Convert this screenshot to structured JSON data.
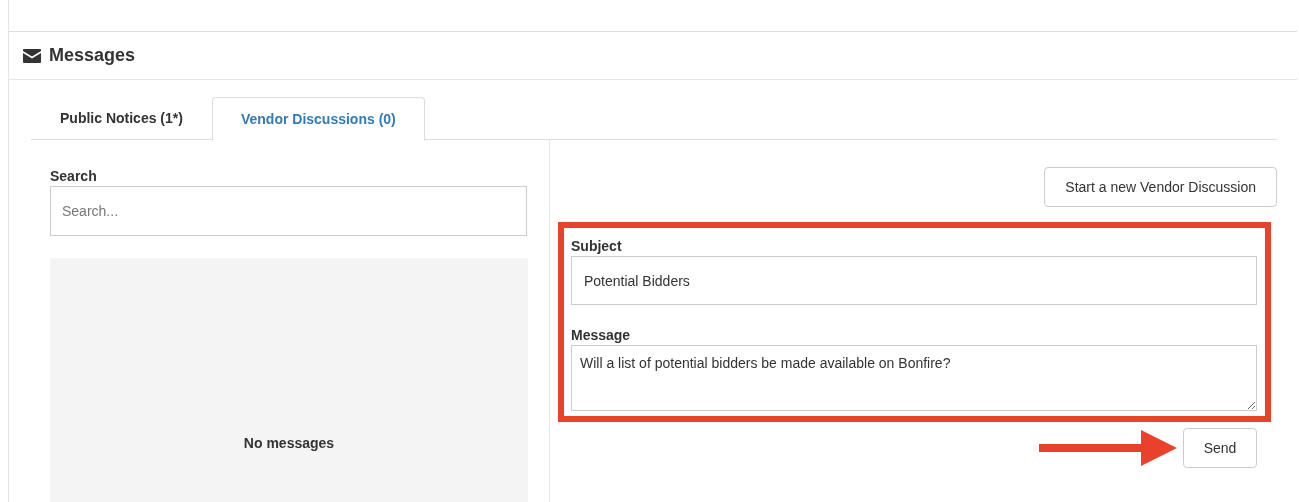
{
  "panel": {
    "title": "Messages"
  },
  "tabs": [
    {
      "label": "Public Notices (1*)",
      "selected": false
    },
    {
      "label": "Vendor Discussions (0)",
      "selected": true
    }
  ],
  "search": {
    "label": "Search",
    "placeholder": "Search..."
  },
  "message_list": {
    "empty_text": "No messages"
  },
  "new_discussion_button": "Start a new Vendor Discussion",
  "form": {
    "subject_label": "Subject",
    "subject_value": "Potential Bidders",
    "message_label": "Message",
    "message_value": "Will a list of potential bidders be made available on Bonfire?",
    "highlighted": true
  },
  "send_button": "Send",
  "send_pointer": true
}
